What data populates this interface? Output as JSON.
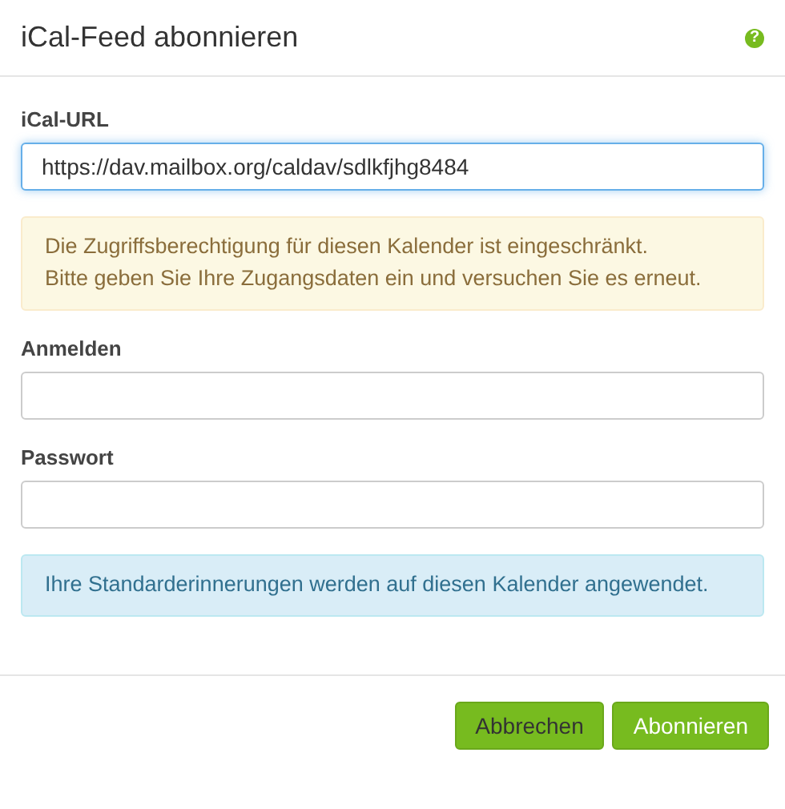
{
  "dialog": {
    "title": "iCal-Feed abonnieren",
    "help_icon": "?"
  },
  "body": [
    {
      "kind": "field",
      "label": "iCal-URL",
      "value": "https://dav.mailbox.org/caldav/sdlkfjhg8484",
      "focused": true
    },
    {
      "kind": "warning",
      "lines": [
        "Die Zugriffsberechtigung für diesen Kalender ist eingeschränkt.",
        "Bitte geben Sie Ihre Zugangsdaten ein und versuchen Sie es erneut."
      ]
    },
    {
      "kind": "field",
      "label": "Anmelden",
      "focused": false
    },
    {
      "kind": "field",
      "label": "Passwort",
      "focused": false
    },
    {
      "kind": "info",
      "lines": [
        "Ihre Standarderinnerungen werden auf diesen Kalender angewendet."
      ]
    }
  ],
  "buttons": [
    {
      "label": "Abbrechen",
      "kind": "default"
    },
    {
      "label": "Abonnieren",
      "kind": "primary"
    }
  ]
}
